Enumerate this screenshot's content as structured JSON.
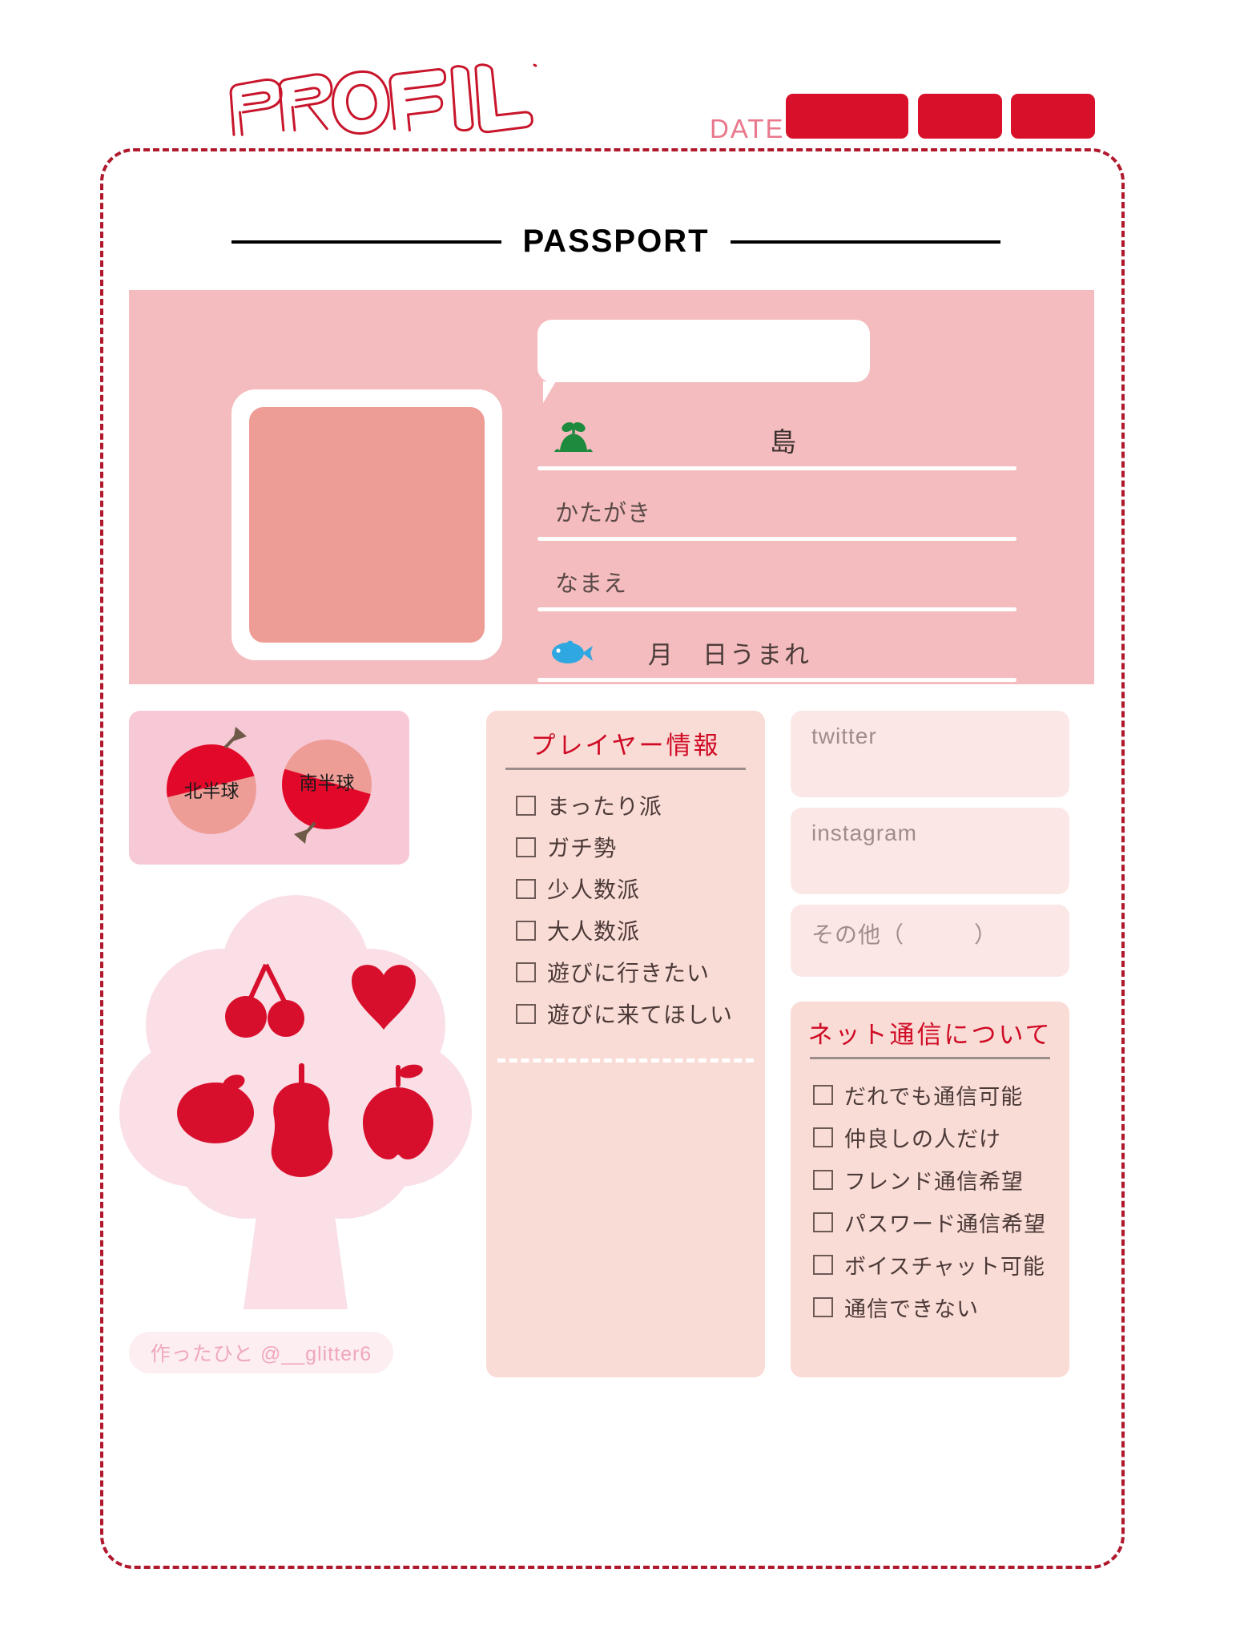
{
  "header": {
    "title": "PROFILE",
    "date_label": "DATE",
    "date_boxes": [
      "",
      "",
      ""
    ]
  },
  "passport": {
    "text": "PASSPORT"
  },
  "idcard": {
    "bubble_text": "",
    "island": {
      "icon": "island-sprout-icon",
      "suffix": "島"
    },
    "rows": [
      {
        "label": "かたがき"
      },
      {
        "label": "なまえ"
      }
    ],
    "birthday": {
      "icon": "fish-icon",
      "text": "月　日うまれ"
    }
  },
  "hemisphere": {
    "north": "北半球",
    "south": "南半球"
  },
  "tree": {
    "fruits": [
      "cherry",
      "peach",
      "orange",
      "pear",
      "apple"
    ]
  },
  "credit": {
    "text": "作ったひと @__glitter6"
  },
  "player_panel": {
    "title": "プレイヤー情報",
    "items": [
      "まったり派",
      "ガチ勢",
      "少人数派",
      "大人数派",
      "遊びに行きたい",
      "遊びに来てほしい"
    ]
  },
  "social": [
    {
      "placeholder": "twitter",
      "value": ""
    },
    {
      "placeholder": "instagram",
      "value": ""
    },
    {
      "placeholder": "その他（　　　）",
      "value": ""
    }
  ],
  "net_panel": {
    "title": "ネット通信について",
    "items": [
      "だれでも通信可能",
      "仲良しの人だけ",
      "フレンド通信希望",
      "パスワード通信希望",
      "ボイスチャット可能",
      "通信できない"
    ]
  },
  "colors": {
    "brand_red": "#d8102a",
    "dark_red": "#b0182c",
    "card_pink": "#f4bcbe",
    "panel_pink": "#fadcd6",
    "soft_pink": "#fbe8e6",
    "hemi_pink": "#f7c8d5",
    "photo_fill": "#ee9d96",
    "tree_pink": "#fadfe6"
  }
}
